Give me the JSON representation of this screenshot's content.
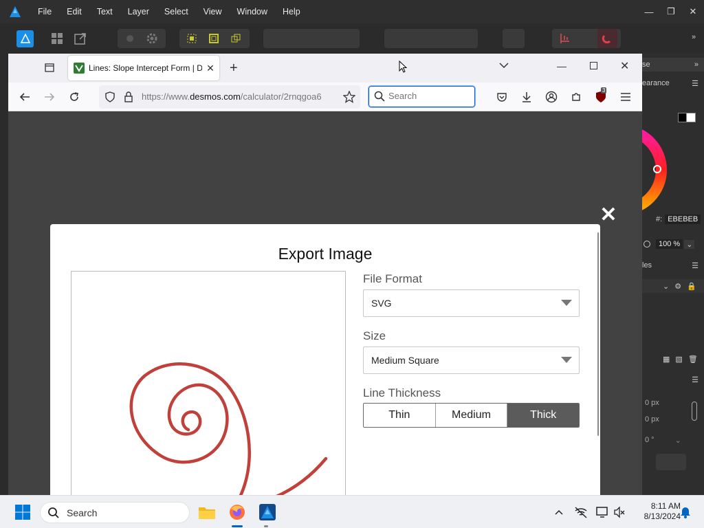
{
  "app": {
    "menu": [
      "File",
      "Edit",
      "Text",
      "Layer",
      "Select",
      "View",
      "Window",
      "Help"
    ]
  },
  "right_panel": {
    "tab_partial": "se",
    "appearance_partial": "earance",
    "hex_label": "#:",
    "hex_value": "EBEBEB",
    "opacity": "100 %",
    "layers_partial": "les",
    "px1": "0 px",
    "px2": "0 px",
    "deg": "0 °"
  },
  "browser": {
    "tab_title": "Lines: Slope Intercept Form | De",
    "url_prefix": "https://www.",
    "url_domain": "desmos.com",
    "url_path": "/calculator/2rnqgoa6",
    "search_placeholder": "Search",
    "addon_badge": "3"
  },
  "dialog": {
    "title": "Export Image",
    "file_format_label": "File Format",
    "file_format_value": "SVG",
    "size_label": "Size",
    "size_value": "Medium Square",
    "thickness_label": "Line Thickness",
    "thickness_options": [
      "Thin",
      "Medium",
      "Thick"
    ],
    "thickness_selected": "Thick",
    "close_glyph": "✕"
  },
  "taskbar": {
    "search_label": "Search",
    "time": "8:11 AM",
    "date": "8/13/2024"
  },
  "colors": {
    "spiral": "#c0413b",
    "firefox_accent": "#0061e0",
    "affinity_blue": "#1b8ee6"
  }
}
